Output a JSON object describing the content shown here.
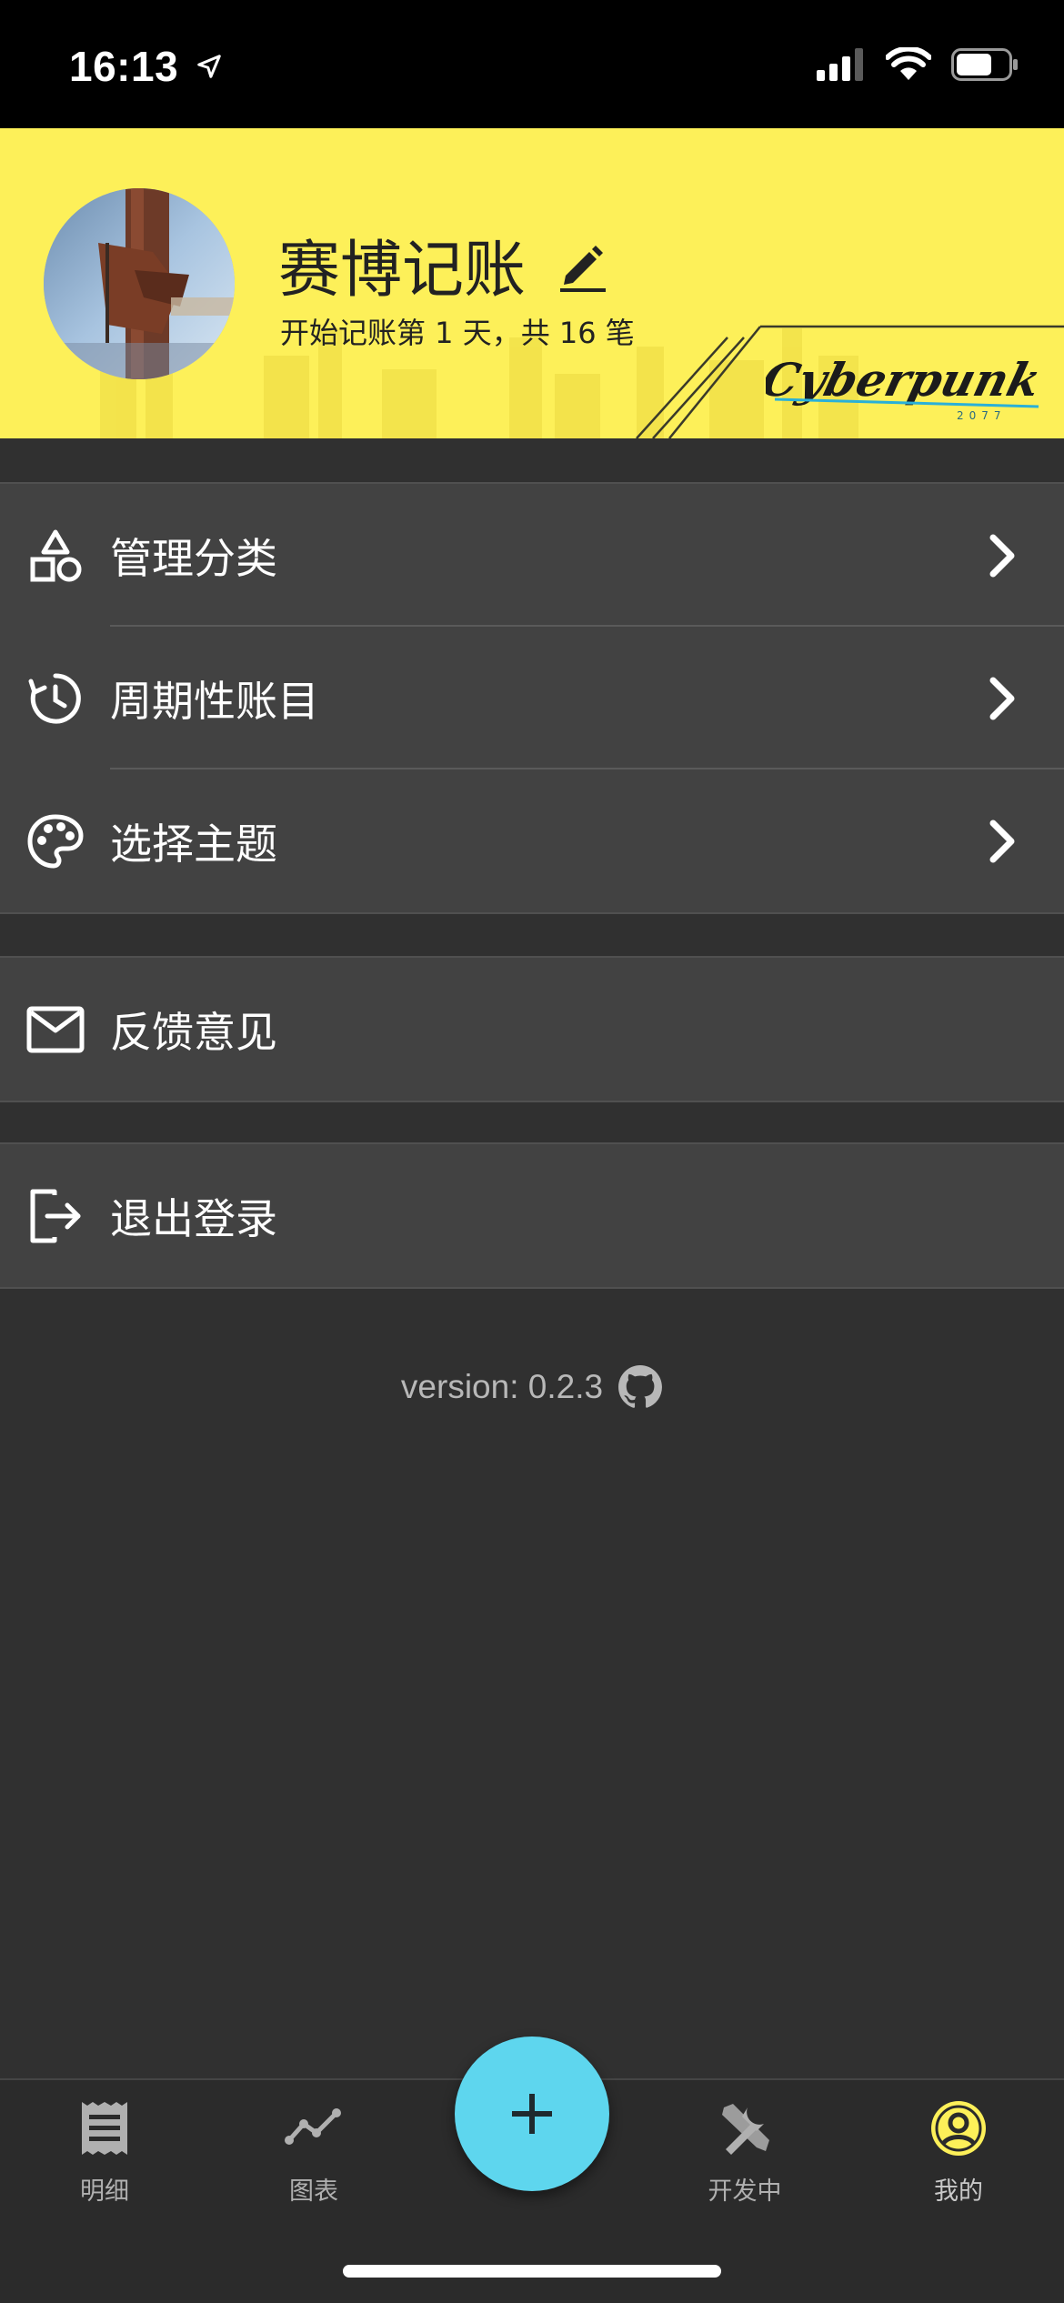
{
  "status_bar": {
    "time": "16:13",
    "location_icon": "location-arrow-icon",
    "signal_icon": "cellular-signal-icon",
    "wifi_icon": "wifi-icon",
    "battery_icon": "battery-icon",
    "battery_level": 0.6
  },
  "header": {
    "background_color": "#fdf059",
    "title": "赛博记账",
    "subtitle": "开始记账第 1 天，共 16 笔",
    "edit_icon": "pencil-icon",
    "logo_text": "Cyberpunk",
    "logo_year": "2077"
  },
  "menu_groups": [
    {
      "items": [
        {
          "icon": "shapes-icon",
          "label": "管理分类"
        },
        {
          "icon": "history-clock-icon",
          "label": "周期性账目"
        },
        {
          "icon": "palette-icon",
          "label": "选择主题"
        }
      ]
    },
    {
      "items": [
        {
          "icon": "mail-icon",
          "label": "反馈意见"
        }
      ]
    },
    {
      "items": [
        {
          "icon": "logout-icon",
          "label": "退出登录"
        }
      ]
    }
  ],
  "footer": {
    "version_text": "version: 0.2.3",
    "github_icon": "github-icon"
  },
  "tabbar": {
    "tabs": [
      {
        "icon": "receipt-icon",
        "label": "明细"
      },
      {
        "icon": "chart-line-icon",
        "label": "图表"
      },
      {
        "icon": "tools-icon",
        "label": "开发中"
      },
      {
        "icon": "account-circle-icon",
        "label": "我的",
        "active": true
      }
    ],
    "fab_icon": "plus-icon",
    "fab_color": "#5ed6ee",
    "active_color": "#fdf059"
  }
}
